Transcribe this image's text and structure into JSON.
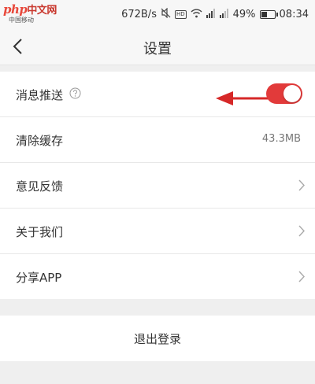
{
  "watermark": {
    "text": "php",
    "cn": "中文网"
  },
  "status_bar": {
    "carrier": "中国移动",
    "speed": "672B/s",
    "battery": "49%",
    "time": "08:34",
    "battery_level": 0.49,
    "icons": [
      "mute-icon",
      "hd-icon",
      "wifi-icon",
      "signal-icon",
      "signal-icon-2",
      "battery-icon"
    ]
  },
  "nav": {
    "title": "设置",
    "back_icon": "chevron-left-icon"
  },
  "settings": {
    "push": {
      "label": "消息推送",
      "enabled": true
    },
    "cache": {
      "label": "清除缓存",
      "value": "43.3MB"
    },
    "feedback": {
      "label": "意见反馈"
    },
    "about": {
      "label": "关于我们"
    },
    "share": {
      "label": "分享APP"
    }
  },
  "logout": {
    "label": "退出登录"
  },
  "colors": {
    "accent": "#e23a3a",
    "arrow": "#d62828",
    "background": "#efefef"
  }
}
